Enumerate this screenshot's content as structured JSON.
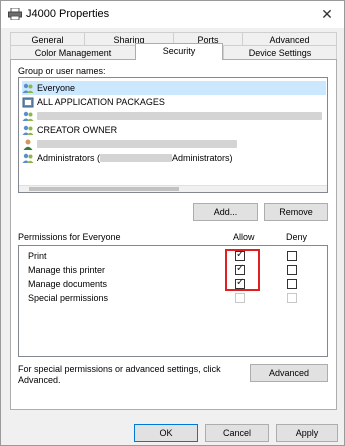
{
  "window": {
    "title": "J4000 Properties",
    "close_glyph": "✕"
  },
  "tabs_row1": [
    "General",
    "Sharing",
    "Ports",
    "Advanced"
  ],
  "tabs_row2": [
    "Color Management",
    "Security",
    "Device Settings"
  ],
  "active_tab": "Security",
  "security": {
    "group_label": "Group or user names:",
    "users": [
      {
        "name": "Everyone",
        "icon": "group-icon"
      },
      {
        "name": "ALL APPLICATION PACKAGES",
        "icon": "package-icon"
      },
      {
        "name": "",
        "icon": "group-icon"
      },
      {
        "name": "CREATOR OWNER",
        "icon": "group-icon"
      },
      {
        "name": "",
        "icon": "user-icon"
      },
      {
        "name_prefix": "Administrators (",
        "name_suffix": "Administrators)",
        "icon": "group-icon"
      }
    ],
    "add_button": "Add...",
    "remove_button": "Remove",
    "permissions_label": "Permissions for Everyone",
    "allow_header": "Allow",
    "deny_header": "Deny",
    "permissions": [
      {
        "name": "Print",
        "allow": true,
        "deny": false,
        "enabled": true
      },
      {
        "name": "Manage this printer",
        "allow": true,
        "deny": false,
        "enabled": true
      },
      {
        "name": "Manage documents",
        "allow": true,
        "deny": false,
        "enabled": true
      },
      {
        "name": "Special permissions",
        "allow": false,
        "deny": false,
        "enabled": false
      }
    ],
    "special_text_line1": "For special permissions or advanced settings, click",
    "special_text_line2": "Advanced.",
    "advanced_button": "Advanced"
  },
  "footer": {
    "ok": "OK",
    "cancel": "Cancel",
    "apply": "Apply"
  },
  "colors": {
    "highlight": "#e02020",
    "default_button_border": "#0078d7"
  }
}
